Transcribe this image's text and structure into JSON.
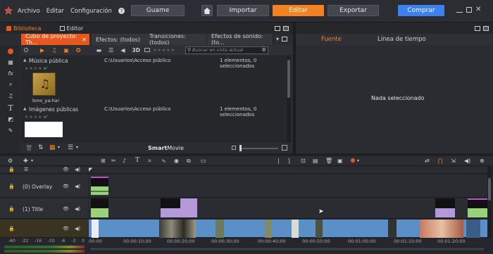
{
  "menu": {
    "archivo": "Archivo",
    "editar": "Editar",
    "configuracion": "Configuración"
  },
  "topbar": {
    "guame": "Guame",
    "importar": "Importar",
    "editar": "Editar",
    "exportar": "Exportar",
    "comprar": "Comprar"
  },
  "left": {
    "tab_biblioteca": "Biblioteca",
    "tab_editor": "Editor",
    "lib_tabs": [
      "Cubo de proyecto: Th...",
      "Efectos: (todos)",
      "Transiciones: (todos)",
      "Efectos de sonido: (to..."
    ],
    "search_placeholder": "Buscar en vista actual",
    "mode_3d": "3D",
    "sections": [
      {
        "title": "Música pública",
        "path": "C:\\Usuarios\\Acceso público",
        "count": "1 elementos, 0 seleccionados",
        "item_label": "bmx_ya-ha!"
      },
      {
        "title": "Imágenes públicas",
        "path": "C:\\Usuarios\\Acceso público",
        "count": "1 elementos, 0 seleccionados"
      }
    ],
    "smart_a": "Smart",
    "smart_b": "Movie"
  },
  "right": {
    "tab_fuente": "Fuente",
    "tab_timeline": "Línea de tiempo",
    "empty": "Nada seleccionado"
  },
  "timeline": {
    "tracks": [
      {
        "name": "(0) Overlay"
      },
      {
        "name": "(1) Title"
      }
    ],
    "ruler": [
      "00:00",
      "00:00:10;00",
      "00:00:20;00",
      "00:00:30;00",
      "00:00:40;00",
      "00:00:50;00",
      "00:01:00;00",
      "00:01:10;00",
      "00:01:20;00"
    ],
    "meter": [
      "-60",
      "-22",
      "-16",
      "-10",
      "-6",
      "-3",
      "0"
    ]
  },
  "colors": {
    "accent": "#f58220",
    "buy": "#3b82f0",
    "lib_tab_active": "#e8571e"
  }
}
